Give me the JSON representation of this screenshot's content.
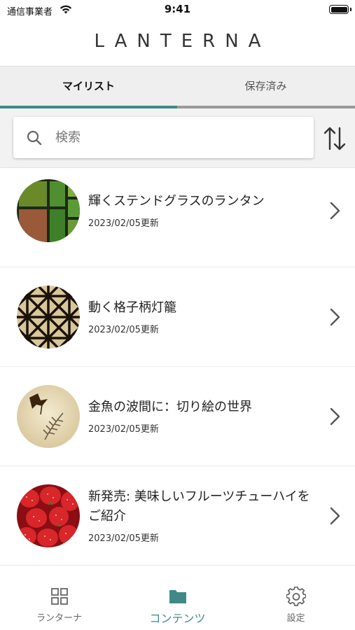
{
  "status_bar": {
    "carrier": "通信事業者",
    "time": "9:41"
  },
  "app": {
    "title": "LANTERNA"
  },
  "tabs": [
    {
      "label": "マイリスト",
      "active": true
    },
    {
      "label": "保存済み",
      "active": false
    }
  ],
  "search": {
    "placeholder": "検索",
    "value": ""
  },
  "items": [
    {
      "title": "輝くステンドグラスのランタン",
      "date": "2023/02/05更新",
      "thumbnail": "stained-glass"
    },
    {
      "title": "動く格子柄灯籠",
      "date": "2023/02/05更新",
      "thumbnail": "lattice-pattern"
    },
    {
      "title": "金魚の波間に：切り絵の世界",
      "date": "2023/02/05更新",
      "thumbnail": "goldfish-paper-cut"
    },
    {
      "title": "新発売: 美味しいフルーツチューハイをご紹介",
      "date": "2023/02/05更新",
      "thumbnail": "strawberries"
    }
  ],
  "bottom_nav": [
    {
      "label": "ランターナ",
      "icon": "grid-icon",
      "active": false
    },
    {
      "label": "コンテンツ",
      "icon": "folder-icon",
      "active": true
    },
    {
      "label": "設定",
      "icon": "gear-icon",
      "active": false
    }
  ],
  "colors": {
    "accent": "#3f8a86",
    "tab_bar_bg": "#efefef",
    "search_area_bg": "#f2f2f2"
  }
}
